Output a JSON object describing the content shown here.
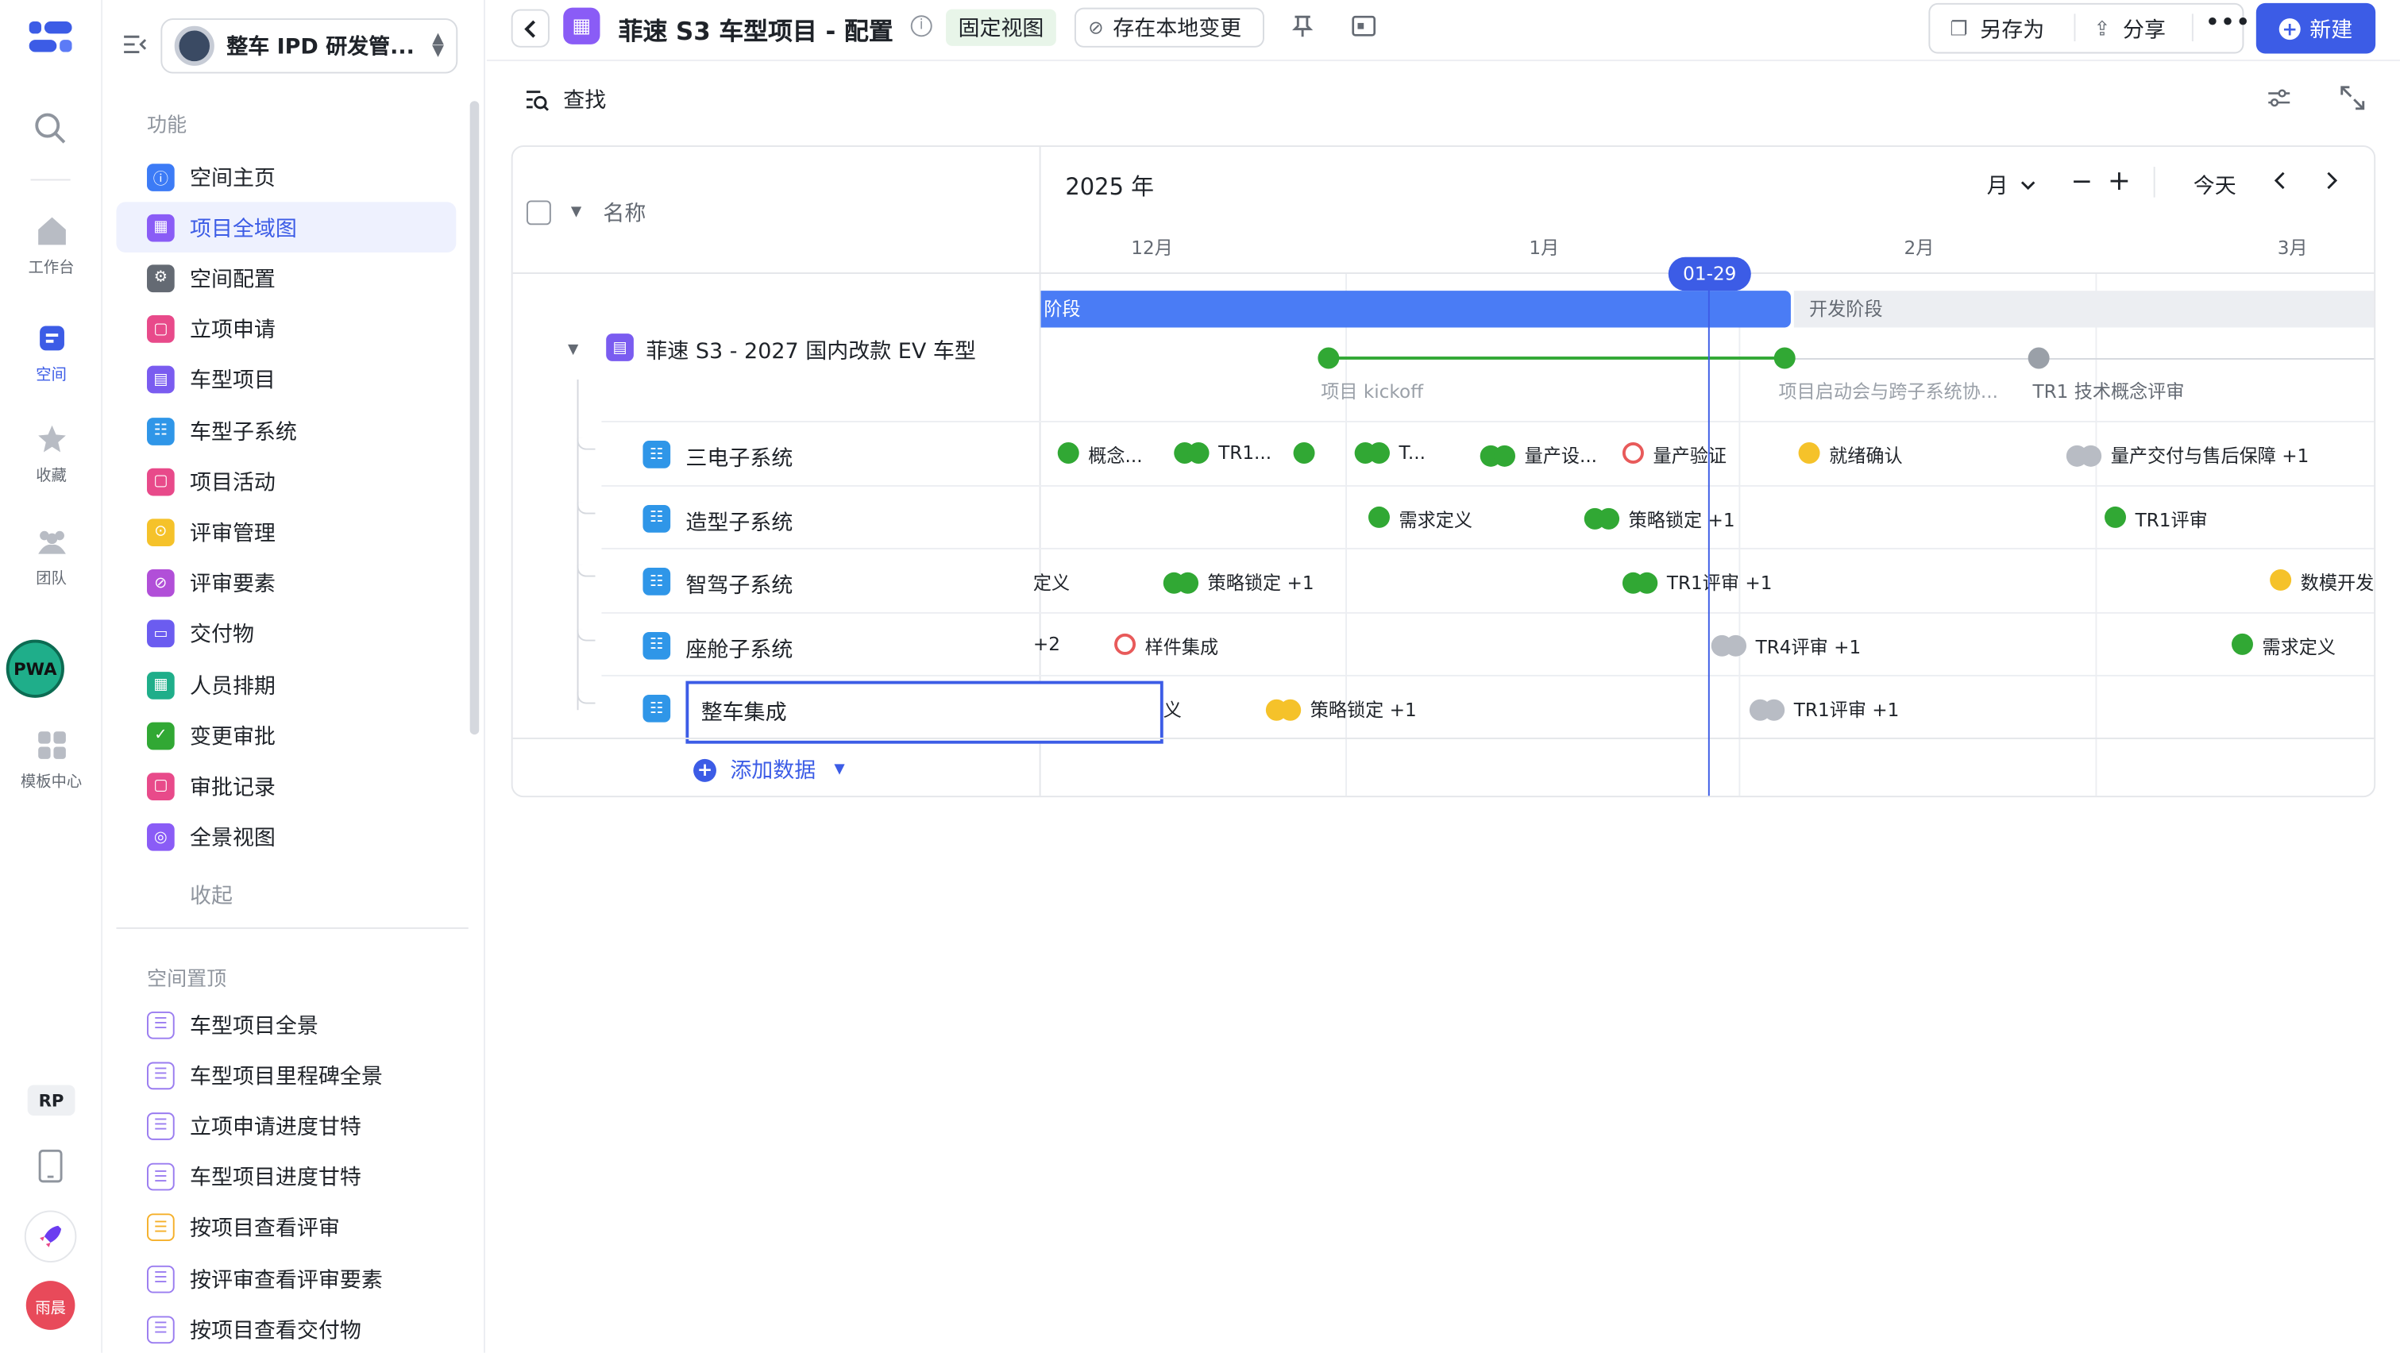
{
  "rail": {
    "items": [
      {
        "label": "工作台",
        "icon": "home-icon"
      },
      {
        "label": "空间",
        "icon": "space-icon"
      },
      {
        "label": "收藏",
        "icon": "star-icon"
      },
      {
        "label": "团队",
        "icon": "team-icon"
      },
      {
        "label": "模板中心",
        "icon": "template-icon"
      }
    ],
    "pwa_badge": "PWA",
    "rp_badge": "RP",
    "user_avatar": "雨晨"
  },
  "space": {
    "name": "整车 IPD 研发管..."
  },
  "sidebar": {
    "section_features": "功能",
    "items": [
      {
        "label": "空间主页",
        "color": "#3c7bf6",
        "glyph": "ⓘ"
      },
      {
        "label": "项目全域图",
        "color": "#8a5cf6",
        "glyph": "▦"
      },
      {
        "label": "空间配置",
        "color": "#646a73",
        "glyph": "⚙"
      },
      {
        "label": "立项申请",
        "color": "#e84a8a",
        "glyph": "▢"
      },
      {
        "label": "车型项目",
        "color": "#7a5cf0",
        "glyph": "▤"
      },
      {
        "label": "车型子系统",
        "color": "#2f96e8",
        "glyph": "☷"
      },
      {
        "label": "项目活动",
        "color": "#e84a8a",
        "glyph": "▢"
      },
      {
        "label": "评审管理",
        "color": "#f5c22a",
        "glyph": "⊙"
      },
      {
        "label": "评审要素",
        "color": "#b14fd8",
        "glyph": "⊘"
      },
      {
        "label": "交付物",
        "color": "#6b5cf0",
        "glyph": "▭"
      },
      {
        "label": "人员排期",
        "color": "#1fae8a",
        "glyph": "▦"
      },
      {
        "label": "变更审批",
        "color": "#31a834",
        "glyph": "✓"
      },
      {
        "label": "审批记录",
        "color": "#e84a8a",
        "glyph": "▢"
      },
      {
        "label": "全景视图",
        "color": "#8a5cf6",
        "glyph": "◎"
      }
    ],
    "collapse": "收起",
    "section_pinned": "空间置顶",
    "pinned": [
      {
        "label": "车型项目全景",
        "color": "#9a7cf0"
      },
      {
        "label": "车型项目里程碑全景",
        "color": "#9a7cf0"
      },
      {
        "label": "立项申请进度甘特",
        "color": "#9a7cf0"
      },
      {
        "label": "车型项目进度甘特",
        "color": "#9a7cf0"
      },
      {
        "label": "按项目查看评审",
        "color": "#f5b02a"
      },
      {
        "label": "按评审查看评审要素",
        "color": "#9a7cf0"
      },
      {
        "label": "按项目查看交付物",
        "color": "#9a7cf0"
      }
    ]
  },
  "topbar": {
    "title": "菲速 S3 车型项目 - 配置",
    "fixed_view": "固定视图",
    "save_local": "存在本地变更",
    "save_as": "另存为",
    "share": "分享",
    "new": "新建"
  },
  "toolbar": {
    "search": "查找"
  },
  "gantt": {
    "name_header": "名称",
    "year": "2025 年",
    "scale": "月",
    "today": "今天",
    "months": [
      "12月",
      "1月",
      "2月",
      "3月"
    ],
    "today_label": "01-29",
    "project": {
      "name": "菲速 S3 - 2027 国内改款 EV 车型",
      "phase_current": "阶段",
      "phase_next": "开发阶段",
      "milestones": [
        "项目 kickoff",
        "项目启动会与跨子系统协...",
        "TR1 技术概念评审"
      ]
    },
    "rows": [
      {
        "name": "三电子系统",
        "marks": [
          {
            "text": "概念...",
            "dots": [
              "g"
            ]
          },
          {
            "text": "TR1...",
            "dots": [
              "g",
              "g"
            ]
          },
          {
            "text": "",
            "dots": [
              "g"
            ]
          },
          {
            "text": "T...",
            "dots": [
              "g",
              "g"
            ]
          },
          {
            "text": "量产设...",
            "dots": [
              "g",
              "g"
            ]
          },
          {
            "text": "量产验证",
            "dots": [
              "r"
            ]
          },
          {
            "text": "就绪确认",
            "dots": [
              "y"
            ]
          },
          {
            "text": "量产交付与售后保障 +1",
            "dots": [
              "gr",
              "gr"
            ]
          }
        ]
      },
      {
        "name": "造型子系统",
        "marks": [
          {
            "text": "需求定义",
            "dots": [
              "g"
            ]
          },
          {
            "text": "策略锁定 +1",
            "dots": [
              "g",
              "g"
            ]
          },
          {
            "text": "TR1评审",
            "dots": [
              "g"
            ]
          }
        ]
      },
      {
        "name": "智驾子系统",
        "marks": [
          {
            "text": "定义",
            "dots": []
          },
          {
            "text": "策略锁定 +1",
            "dots": [
              "g",
              "g"
            ]
          },
          {
            "text": "TR1评审 +1",
            "dots": [
              "g",
              "g"
            ]
          },
          {
            "text": "数模开发",
            "dots": [
              "y"
            ]
          }
        ]
      },
      {
        "name": "座舱子系统",
        "marks": [
          {
            "text": "+2",
            "dots": []
          },
          {
            "text": "样件集成",
            "dots": [
              "r"
            ]
          },
          {
            "text": "TR4评审 +1",
            "dots": [
              "gr",
              "gr"
            ]
          },
          {
            "text": "需求定义",
            "dots": [
              "g"
            ]
          }
        ]
      },
      {
        "name": "整车集成",
        "marks": [
          {
            "text": "义",
            "dots": []
          },
          {
            "text": "策略锁定 +1",
            "dots": [
              "y",
              "y"
            ]
          },
          {
            "text": "TR1评审 +1",
            "dots": [
              "gr",
              "gr"
            ]
          }
        ]
      }
    ],
    "add_data": "添加数据"
  }
}
